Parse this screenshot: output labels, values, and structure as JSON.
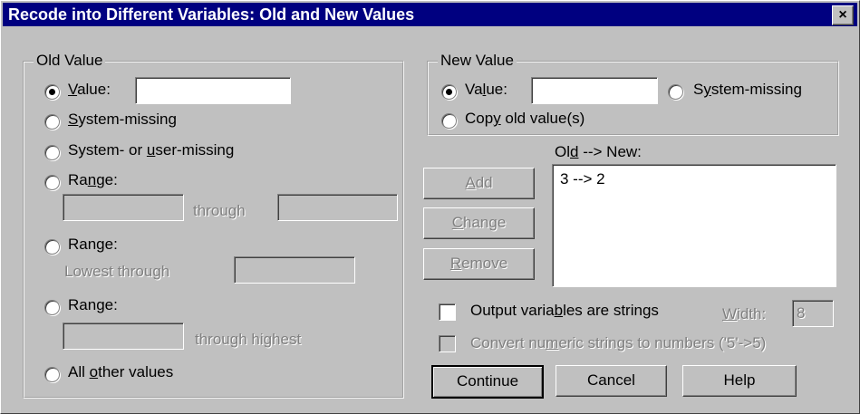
{
  "window": {
    "title": "Recode into Different Variables: Old and New Values",
    "close_glyph": "×"
  },
  "old_value": {
    "legend": "Old Value",
    "value_label_u": "V",
    "value_label_rest": "alue:",
    "value_input": "",
    "system_missing_u": "S",
    "system_missing_rest": "ystem-missing",
    "sys_user_missing_pre": "System- or ",
    "sys_user_missing_u": "u",
    "sys_user_missing_rest": "ser-missing",
    "range1_pre": "Ra",
    "range1_u": "n",
    "range1_rest": "ge:",
    "through_label": "through",
    "range2_label": "Range:",
    "lowest_through_label": "Lowest through",
    "range3_pre": "Ran",
    "range3_u": "g",
    "range3_rest": "e:",
    "through_highest_label": "through highest",
    "all_other_pre": "All ",
    "all_other_u": "o",
    "all_other_rest": "ther values"
  },
  "new_value": {
    "legend": "New Value",
    "value_label_u": "l",
    "value_label_pre": "Va",
    "value_label_rest": "ue:",
    "value_input": "",
    "system_missing_pre": "S",
    "system_missing_u": "y",
    "system_missing_rest": "stem-missing",
    "copy_pre": "Cop",
    "copy_u": "y",
    "copy_rest": " old value(s)"
  },
  "mapping": {
    "label_pre": "Ol",
    "label_u": "d",
    "label_rest": " --> New:",
    "items": [
      "3 --> 2"
    ]
  },
  "buttons": {
    "add_u": "A",
    "add_rest": "dd",
    "change_u": "C",
    "change_rest": "hange",
    "remove_u": "R",
    "remove_rest": "emove",
    "continue": "Continue",
    "cancel": "Cancel",
    "help": "Help"
  },
  "options": {
    "output_strings_pre": "Output varia",
    "output_strings_u": "b",
    "output_strings_rest": "les are strings",
    "width_u": "W",
    "width_rest": "idth:",
    "width_value": "8",
    "convert_pre": "Convert nu",
    "convert_u": "m",
    "convert_rest": "eric strings to numbers ('5'->5)"
  }
}
